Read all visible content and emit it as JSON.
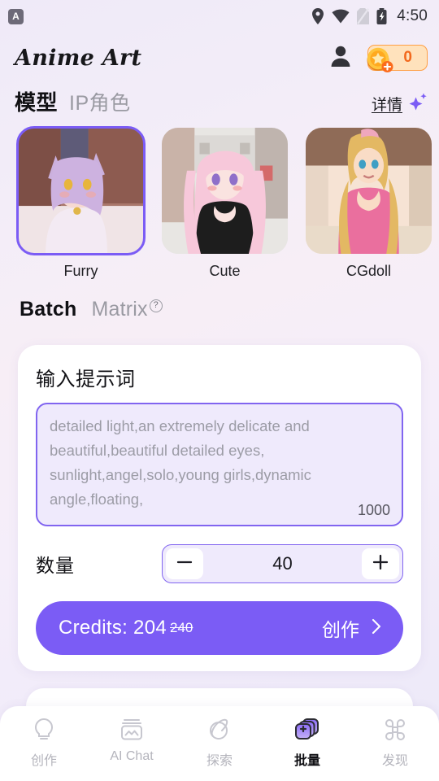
{
  "statusbar": {
    "app_badge_letter": "A",
    "time": "4:50",
    "icons": [
      "location-pin-icon",
      "wifi-icon",
      "sim-off-icon",
      "battery-charging-icon"
    ]
  },
  "header": {
    "app_title": "Anime Art",
    "profile_icon": "person-icon",
    "coin_count": "0",
    "coin_icon": "star-coin-icon",
    "add_icon": "plus-circle-icon"
  },
  "model_section": {
    "tabs": [
      {
        "label": "模型",
        "active": true
      },
      {
        "label": "IP角色",
        "active": false
      }
    ],
    "detail_link": "详情",
    "sparkle_icon": "sparkle-icon",
    "thumbnails": [
      {
        "label": "Furry",
        "selected": true
      },
      {
        "label": "Cute",
        "selected": false
      },
      {
        "label": "CGdoll",
        "selected": false
      },
      {
        "label": "",
        "selected": false
      }
    ]
  },
  "section_tabs": [
    {
      "label": "Batch",
      "active": true,
      "help": false
    },
    {
      "label": "Matrix",
      "active": false,
      "help": true
    }
  ],
  "prompt_card": {
    "title": "输入提示词",
    "prompt_value": "detailed light,an extremely delicate and beautiful,beautiful detailed eyes, sunlight,angel,solo,young girls,dynamic angle,floating,",
    "char_count": "1000",
    "quantity_label": "数量",
    "quantity_value": "40",
    "minus_icon": "minus-icon",
    "plus_icon": "plus-icon"
  },
  "credits_button": {
    "label": "Credits: 204",
    "original_price": "240",
    "cta": "创作",
    "chevron_icon": "chevron-right-icon",
    "color": "#7b5cf5"
  },
  "bottom_nav": [
    {
      "label": "创作",
      "icon": "lightbulb-icon",
      "active": false
    },
    {
      "label": "AI Chat",
      "icon": "photo-stack-icon",
      "active": false
    },
    {
      "label": "探索",
      "icon": "planet-icon",
      "active": false
    },
    {
      "label": "批量",
      "icon": "batch-layers-plus-icon",
      "active": true
    },
    {
      "label": "发现",
      "icon": "grid-flower-icon",
      "active": false
    }
  ]
}
